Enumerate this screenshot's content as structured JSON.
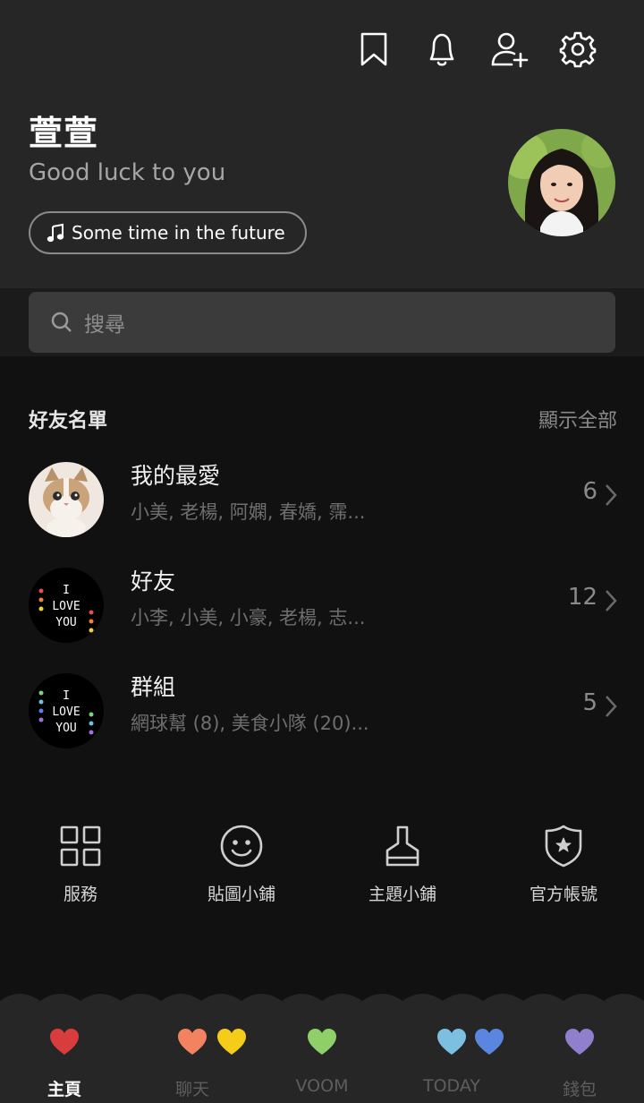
{
  "header": {
    "icons": [
      "bookmark-icon",
      "bell-icon",
      "add-friend-icon",
      "gear-icon"
    ],
    "name": "萱萱",
    "status_message": "Good luck to you",
    "music": "Some time in the future"
  },
  "search": {
    "placeholder": "搜尋"
  },
  "friends_section": {
    "title": "好友名單",
    "show_all": "顯示全部",
    "rows": [
      {
        "title": "我的最愛",
        "members": "小美, 老楊, 阿嫻, 春嬌, 霈...",
        "count": "6"
      },
      {
        "title": "好友",
        "members": "小李, 小美, 小豪, 老楊, 志...",
        "count": "12"
      },
      {
        "title": "群組",
        "members": "網球幫 (8), 美食小隊 (20)...",
        "count": "5"
      }
    ]
  },
  "thumb_text": {
    "line1": "I",
    "line2": "LOVE",
    "line3": "YOU"
  },
  "shortcuts": [
    {
      "label": "服務",
      "icon": "grid-icon"
    },
    {
      "label": "貼圖小鋪",
      "icon": "smiley-icon"
    },
    {
      "label": "主題小鋪",
      "icon": "brush-icon"
    },
    {
      "label": "官方帳號",
      "icon": "shield-star-icon"
    }
  ],
  "tabbar": {
    "tabs": [
      {
        "label": "主頁",
        "color": "#d93c3c",
        "active": true
      },
      {
        "label": "聊天",
        "color": "#f28260"
      },
      {
        "label": "VOOM",
        "color": "#8fcf6a"
      },
      {
        "label": "TODAY",
        "color": "#7cbfe0"
      },
      {
        "label": "錢包",
        "color": "#8f7fcc"
      }
    ],
    "decorative_hearts": [
      "#f5cc1a",
      "#5b86e0"
    ]
  }
}
